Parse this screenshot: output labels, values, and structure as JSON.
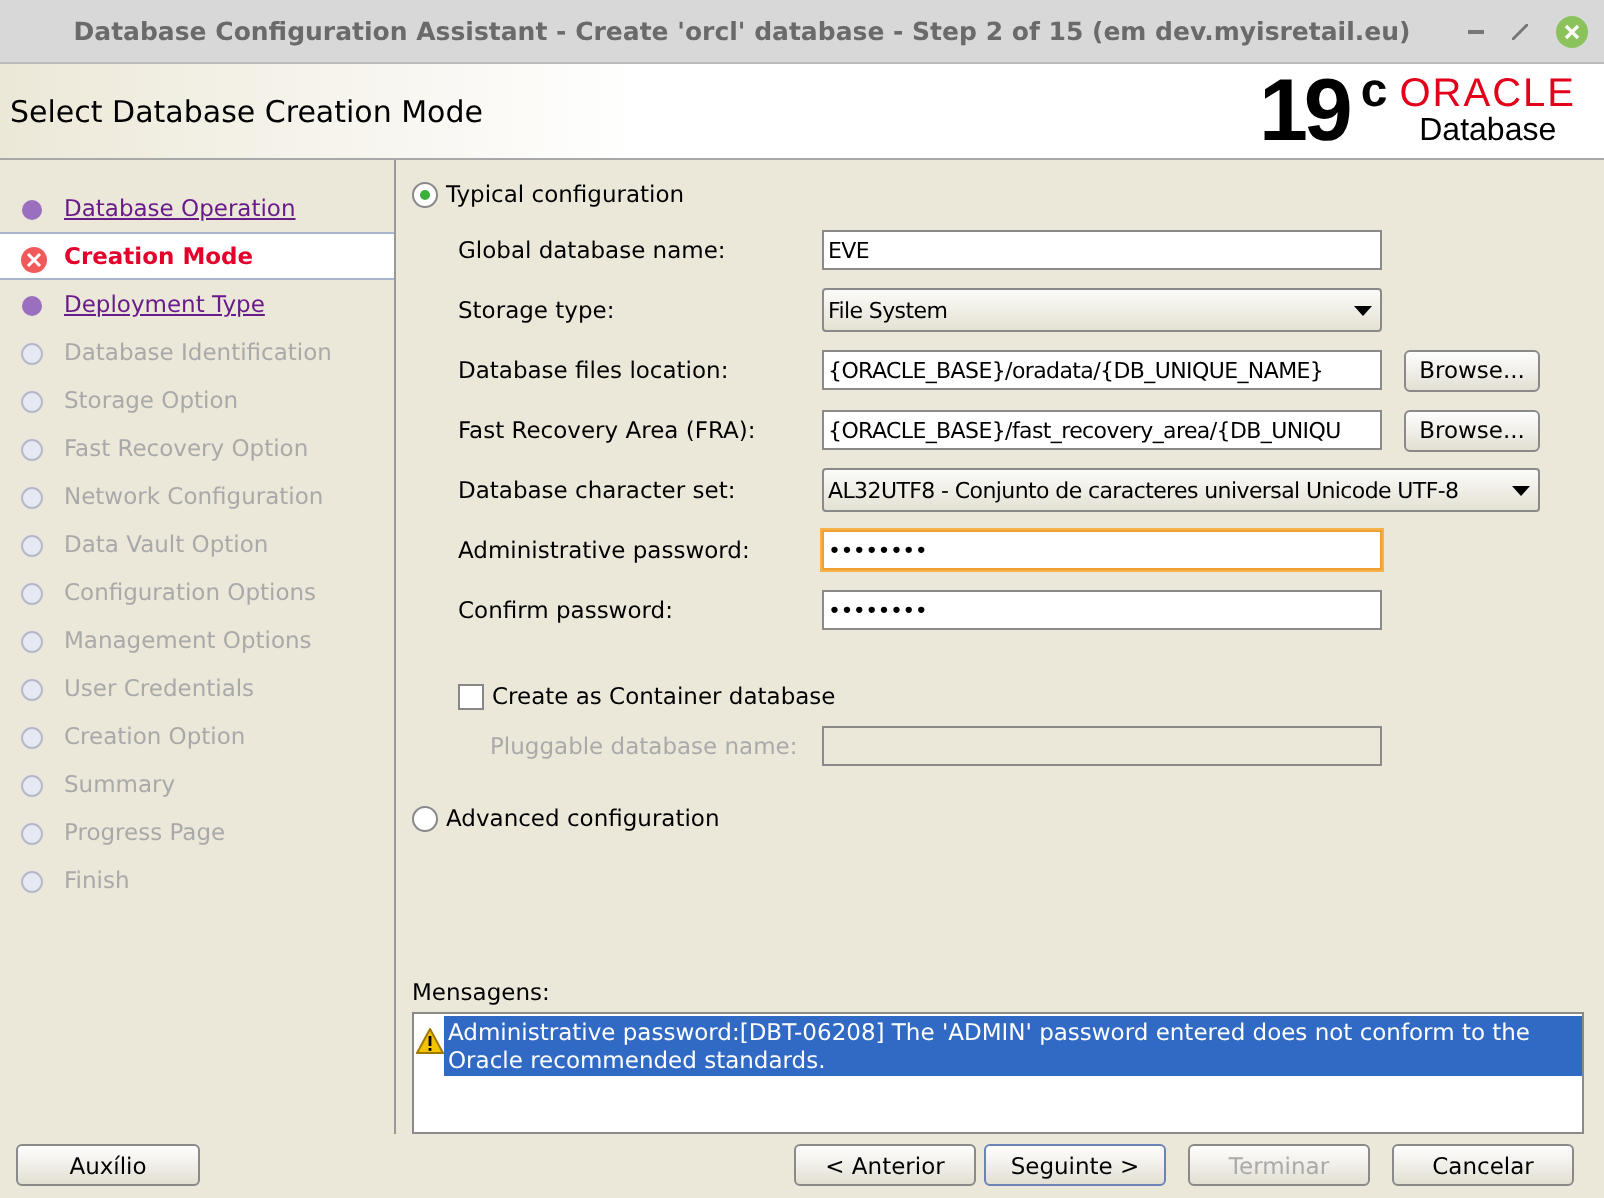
{
  "window": {
    "title": "Database Configuration Assistant - Create 'orcl' database - Step 2 of 15 (em dev.myisretail.eu)"
  },
  "header": {
    "title": "Select Database Creation Mode",
    "logo_version": "19",
    "logo_sup": "c",
    "logo_brand": "ORACLE",
    "logo_product": "Database"
  },
  "steps": [
    {
      "label": "Database Operation",
      "selected": false,
      "disabled": false
    },
    {
      "label": "Creation Mode",
      "selected": true,
      "disabled": false
    },
    {
      "label": "Deployment Type",
      "selected": false,
      "disabled": false
    },
    {
      "label": "Database Identification",
      "selected": false,
      "disabled": true
    },
    {
      "label": "Storage Option",
      "selected": false,
      "disabled": true
    },
    {
      "label": "Fast Recovery Option",
      "selected": false,
      "disabled": true
    },
    {
      "label": "Network Configuration",
      "selected": false,
      "disabled": true
    },
    {
      "label": "Data Vault Option",
      "selected": false,
      "disabled": true
    },
    {
      "label": "Configuration Options",
      "selected": false,
      "disabled": true
    },
    {
      "label": "Management Options",
      "selected": false,
      "disabled": true
    },
    {
      "label": "User Credentials",
      "selected": false,
      "disabled": true
    },
    {
      "label": "Creation Option",
      "selected": false,
      "disabled": true
    },
    {
      "label": "Summary",
      "selected": false,
      "disabled": true
    },
    {
      "label": "Progress Page",
      "selected": false,
      "disabled": true
    },
    {
      "label": "Finish",
      "selected": false,
      "disabled": true
    }
  ],
  "typical": {
    "label": "Typical configuration",
    "selected": true
  },
  "fields": [
    {
      "kind": "text",
      "label": "Global database name:",
      "value": "EVE"
    },
    {
      "kind": "select",
      "label": "Storage type:",
      "value": "File System"
    },
    {
      "kind": "browse",
      "label": "Database files location:",
      "value": "{ORACLE_BASE}/oradata/{DB_UNIQUE_NAME}",
      "button": "Browse..."
    },
    {
      "kind": "browse",
      "label": "Fast Recovery Area (FRA):",
      "value": "{ORACLE_BASE}/fast_recovery_area/{DB_UNIQU",
      "button": "Browse..."
    },
    {
      "kind": "wideselect",
      "label": "Database character set:",
      "value": "AL32UTF8 - Conjunto de caracteres universal Unicode UTF-8"
    },
    {
      "kind": "text",
      "label": "Administrative password:",
      "value": "••••••••",
      "focused": true
    },
    {
      "kind": "text",
      "label": "Confirm password:",
      "value": "••••••••",
      "focused": false
    }
  ],
  "container": {
    "label": "Create as Container database",
    "checked": false
  },
  "pluggable": {
    "label": "Pluggable database name:",
    "disabled": true
  },
  "advanced": {
    "label": "Advanced configuration",
    "selected": false
  },
  "messages": {
    "label": "Mensagens:",
    "items": [
      {
        "text": "Administrative password:[DBT-06208] The 'ADMIN' password entered does not conform to the Oracle recommended standards.",
        "selected": true
      }
    ]
  },
  "buttons": {
    "help": {
      "label": "Auxílio",
      "disabled": false
    },
    "nav": [
      {
        "label": "< Anterior",
        "disabled": false,
        "default": false
      },
      {
        "label": "Seguinte >",
        "disabled": false,
        "default": true
      },
      {
        "label": "Terminar",
        "disabled": true,
        "default": false
      },
      {
        "label": "Cancelar",
        "disabled": false,
        "default": false
      }
    ]
  }
}
